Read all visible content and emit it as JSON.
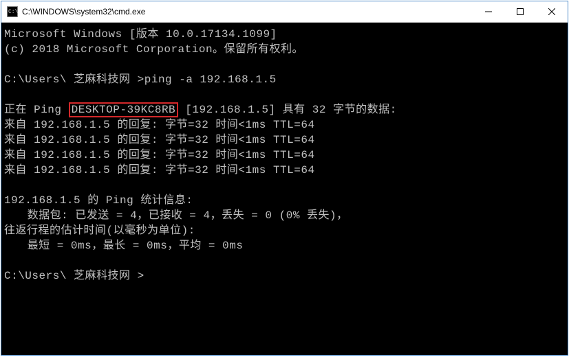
{
  "titlebar": {
    "title": "C:\\WINDOWS\\system32\\cmd.exe",
    "minimize_label": "Minimize",
    "maximize_label": "Maximize",
    "close_label": "Close"
  },
  "terminal": {
    "banner_line1": "Microsoft Windows [版本 10.0.17134.1099]",
    "banner_line2": "(c) 2018 Microsoft Corporation。保留所有权利。",
    "prompt1_path": "C:\\Users\\ 芝麻科技网 >",
    "prompt1_cmd": "ping -a 192.168.1.5",
    "ping_header_prefix": "正在 Ping ",
    "ping_header_hostname": "DESKTOP-39KC8RB",
    "ping_header_suffix": " [192.168.1.5] 具有 32 字节的数据:",
    "replies": [
      "来自 192.168.1.5 的回复: 字节=32 时间<1ms TTL=64",
      "来自 192.168.1.5 的回复: 字节=32 时间<1ms TTL=64",
      "来自 192.168.1.5 的回复: 字节=32 时间<1ms TTL=64",
      "来自 192.168.1.5 的回复: 字节=32 时间<1ms TTL=64"
    ],
    "stats_header": "192.168.1.5 的 Ping 统计信息:",
    "stats_packets": "数据包: 已发送 = 4，已接收 = 4，丢失 = 0 (0% 丢失)，",
    "stats_rtt_header": "往返行程的估计时间(以毫秒为单位):",
    "stats_rtt": "最短 = 0ms，最长 = 0ms，平均 = 0ms",
    "prompt2_path": "C:\\Users\\ 芝麻科技网 >"
  },
  "highlight_color": "#d4282a"
}
